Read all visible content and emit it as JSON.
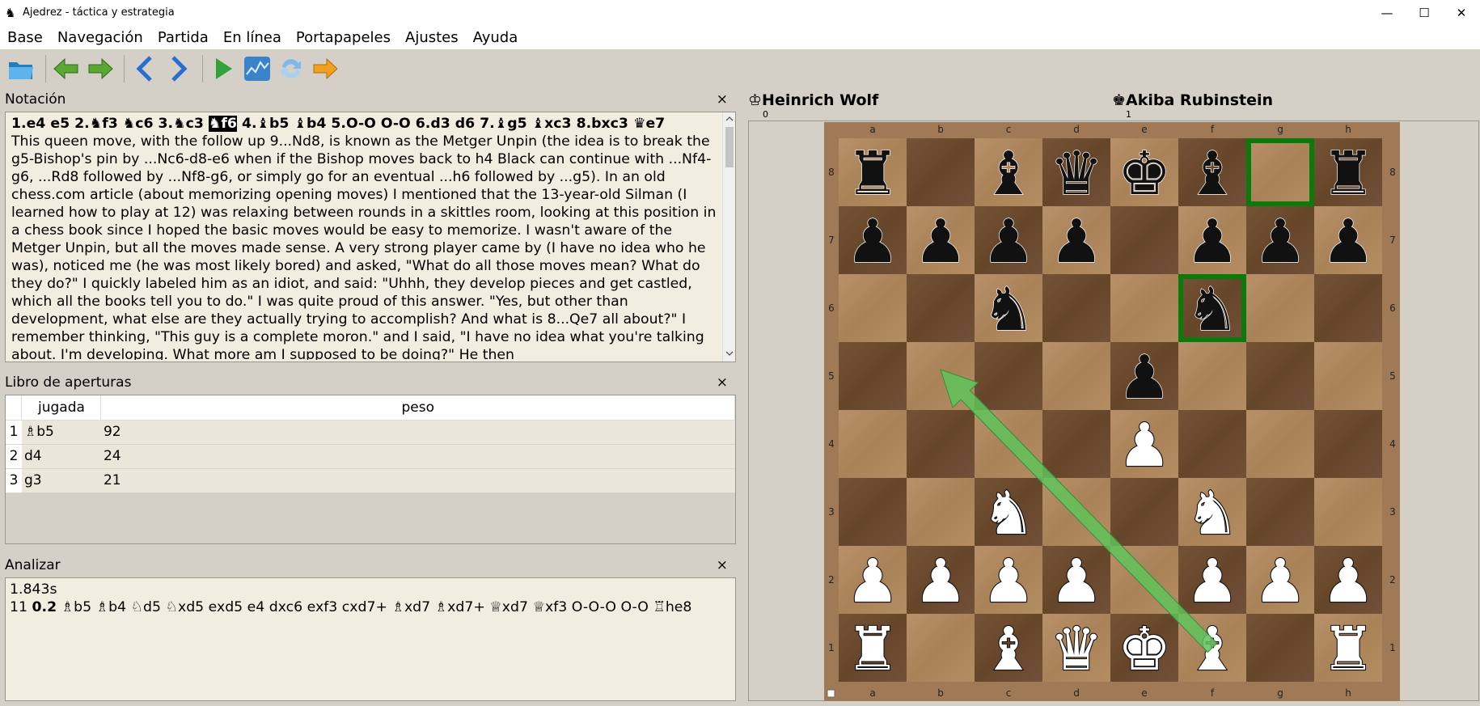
{
  "window": {
    "title": "Ajedrez - táctica y estrategia",
    "controls": {
      "minimize": "—",
      "maximize": "☐",
      "close": "✕"
    }
  },
  "menu": [
    "Base",
    "Navegación",
    "Partida",
    "En línea",
    "Portapapeles",
    "Ajustes",
    "Ayuda"
  ],
  "toolbar": {
    "icons": [
      "folder-open-icon",
      "arrow-left-green-icon",
      "arrow-right-green-icon",
      "chevron-left-blue-icon",
      "chevron-right-blue-icon",
      "play-green-icon",
      "analysis-chart-icon",
      "refresh-icon",
      "arrow-right-orange-icon"
    ]
  },
  "notation": {
    "title": "Notación",
    "close": "×",
    "moves": [
      {
        "t": "1.e4 e5 2.♞f3 ♞c6 3.♞c3 ",
        "s": "bold"
      },
      {
        "t": "♞f6",
        "s": "current"
      },
      {
        "t": " 4.♝b5 ♝b4 5.O-O O-O 6.d3 d6 7.♝g5 ♝xc3 8.bxc3 ♛e7",
        "s": "bold"
      }
    ],
    "comment": "This queen move, with the follow up 9...Nd8, is known as the Metger Unpin (the idea is to break the g5-Bishop's pin by ...Nc6-d8-e6 when if the Bishop moves back to h4 Black can continue with ...Nf4-g6, ...Rd8 followed by ...Nf8-g6, or simply go for an eventual ...h6 followed by ...g5). In an old chess.com article (about memorizing opening moves) I mentioned that the 13-year-old Silman (I learned how to play at 12) was relaxing between rounds in a skittles room, looking at this position in a chess book since I hoped the basic moves would be easy to memorize. I wasn't aware of the Metger Unpin, but all the moves made sense. A very strong player came by (I have no idea who he was), noticed me (he was most likely bored) and asked, \"What do all those moves mean? What do they do?\" I quickly labeled him as an idiot, and said: \"Uhhh, they develop pieces and get castled, which all the books tell you to do.\" I was quite proud of this answer. \"Yes, but other than development, what else are they actually trying to accomplish? And what is 8...Qe7 all about?\" I remember thinking, \"This guy is a complete moron.\" and I said, \"I have no idea what you're talking about. I'm developing. What more am I supposed to be doing?\" He then"
  },
  "book": {
    "title": "Libro de aperturas",
    "close": "×",
    "headers": [
      "jugada",
      "peso"
    ],
    "rows": [
      {
        "n": "1",
        "move": "♗b5",
        "weight": "92"
      },
      {
        "n": "2",
        "move": "d4",
        "weight": "24"
      },
      {
        "n": "3",
        "move": "g3",
        "weight": "21"
      }
    ]
  },
  "analysis": {
    "title": "Analizar",
    "close": "×",
    "time": "1.843s",
    "depth": "11",
    "score": "0.2",
    "line": "♗b5 ♗b4 ♘d5 ♘xd5 exd5 e4 dxc6 exf3 cxd7+ ♗xd7 ♗xd7+ ♕xd7 ♕xf3 O-O-O O-O ♖he8"
  },
  "players": {
    "white": {
      "icon": "♔",
      "name": "Heinrich Wolf",
      "score": "0"
    },
    "black": {
      "icon": "♚",
      "name": "Akiba Rubinstein",
      "score": "1"
    }
  },
  "board": {
    "files": [
      "a",
      "b",
      "c",
      "d",
      "e",
      "f",
      "g",
      "h"
    ],
    "ranks": [
      "8",
      "7",
      "6",
      "5",
      "4",
      "3",
      "2",
      "1"
    ],
    "fen_rows": [
      "r.bqkb.r",
      "pppp.ppp",
      "..n..n..",
      "....p...",
      "....P...",
      "..N..N..",
      "PPPP.PPP",
      "R.BQKB.R"
    ],
    "last_move": {
      "from": "g8",
      "to": "f6"
    },
    "arrow": {
      "from": "f1",
      "to": "b5"
    },
    "colors": {
      "light": "#b08a62",
      "dark": "#6e4d33",
      "highlight": "#0a7a0a",
      "arrow": "#5fc35a"
    }
  }
}
